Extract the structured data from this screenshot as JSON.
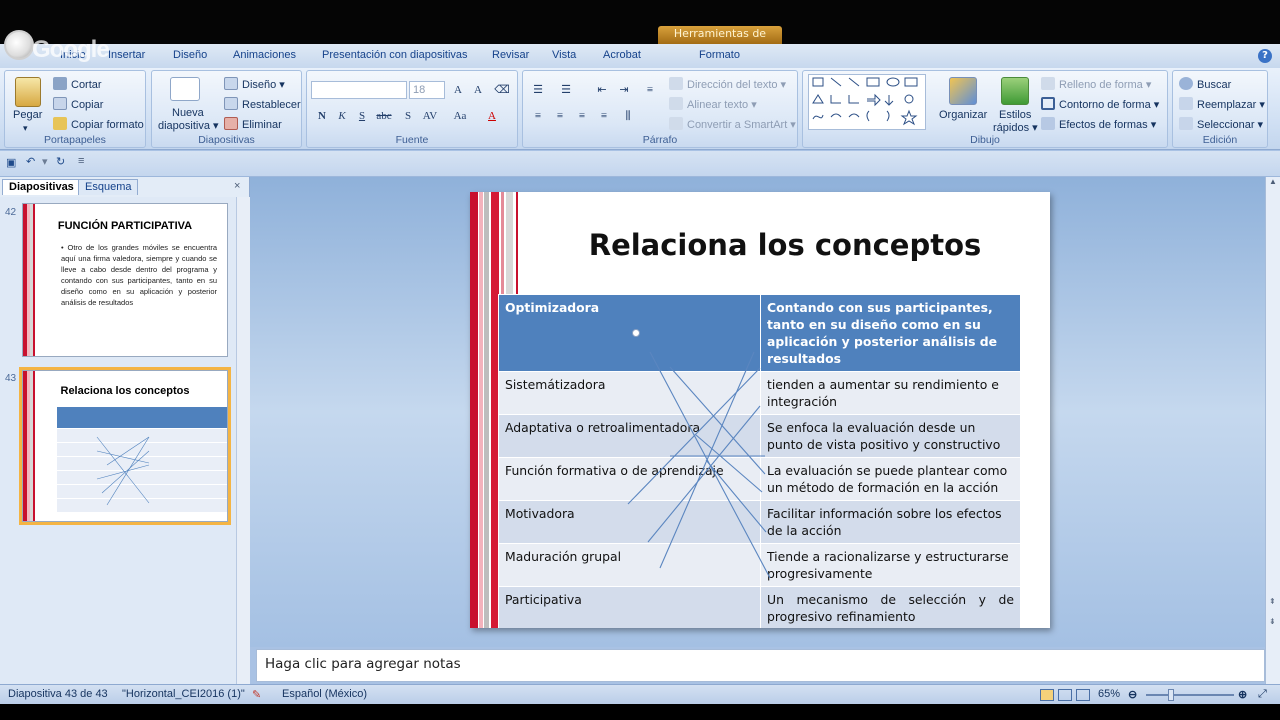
{
  "overlay": {
    "drawing_tools": "Herramientas de dibujo",
    "google_text": "Google"
  },
  "tabs": [
    "Inicio",
    "Insertar",
    "Diseño",
    "Animaciones",
    "Presentación con diapositivas",
    "Revisar",
    "Vista",
    "Acrobat",
    "Formato"
  ],
  "ribbon": {
    "portapapeles": {
      "label": "Portapapeles",
      "pegar": "Pegar",
      "cortar": "Cortar",
      "copiar": "Copiar",
      "copiar_formato": "Copiar formato"
    },
    "diapositivas": {
      "label": "Diapositivas",
      "nueva": "Nueva",
      "diapositiva": "diapositiva",
      "diseno": "Diseño",
      "restablecer": "Restablecer",
      "eliminar": "Eliminar"
    },
    "fuente": {
      "label": "Fuente",
      "font_size": "18"
    },
    "parrafo": {
      "label": "Párrafo",
      "direccion": "Dirección del texto",
      "alinear": "Alinear texto",
      "convertir": "Convertir a SmartArt"
    },
    "dibujo": {
      "label": "Dibujo",
      "organizar": "Organizar",
      "estilos": "Estilos",
      "rapidos": "rápidos",
      "relleno": "Relleno de forma",
      "contorno": "Contorno de forma",
      "efectos": "Efectos de formas"
    },
    "edicion": {
      "label": "Edición",
      "buscar": "Buscar",
      "reemplazar": "Reemplazar",
      "seleccionar": "Seleccionar"
    }
  },
  "panel": {
    "tab_slides": "Diapositivas",
    "tab_outline": "Esquema",
    "thumbs": [
      {
        "num": "42",
        "title": "FUNCIÓN PARTICIPATIVA",
        "body": "Otro de los grandes móviles se encuentra aquí una firma valedora, siempre y cuando se lleve a cabo desde dentro del programa y contando con sus participantes, tanto en su diseño como en su aplicación y posterior análisis de resultados"
      },
      {
        "num": "43",
        "title": "Relaciona los conceptos"
      }
    ]
  },
  "slide": {
    "title": "Relaciona los conceptos",
    "header": {
      "left": "Optimizadora",
      "right": "Contando con sus participantes, tanto en su diseño como en su aplicación y posterior análisis de resultados"
    },
    "rows": [
      {
        "left": "Sistemátizadora",
        "right": "tienden a aumentar su rendimiento e integración"
      },
      {
        "left": "Adaptativa o retroalimentadora",
        "right": "Se enfoca la evaluación desde un punto de vista positivo y constructivo"
      },
      {
        "left": "Función formativa o de aprendizaje",
        "right": "La evaluación se puede plantear como un método de formación en la acción"
      },
      {
        "left": "Motivadora",
        "right": "Facilitar información sobre los efectos de la acción"
      },
      {
        "left": "Maduración grupal",
        "right": "Tiende a racionalizarse y estructurarse progresivamente"
      },
      {
        "left": "Participativa",
        "right": "Un mecanismo de selección y de progresivo refinamiento"
      }
    ]
  },
  "notes": {
    "placeholder": "Haga clic para agregar notas"
  },
  "status": {
    "slide": "Diapositiva 43 de 43",
    "theme": "\"Horizontal_CEI2016 (1)\"",
    "language": "Español (México)",
    "zoom": "65%"
  },
  "colors": {
    "accent": "#4f81bd",
    "stripe_red": "#c8102e",
    "thumb_selected": "#f4b444"
  }
}
